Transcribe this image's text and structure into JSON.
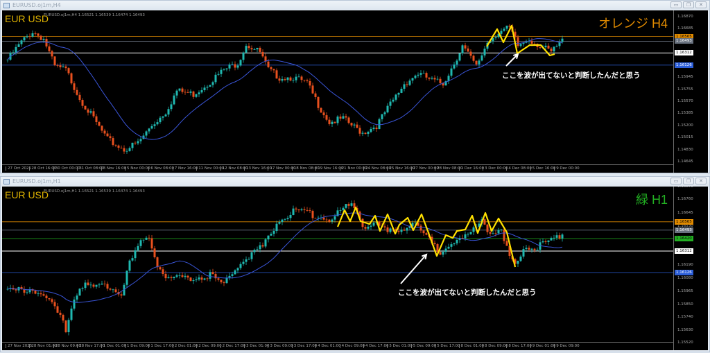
{
  "windows": [
    {
      "title": "EURUSD.oj1m,H4",
      "symbol": "EUR USD",
      "ohlc": "EURUSD.oj1m,H4 1.16521 1.16539 1.16474 1.16493",
      "timeframe_label": "オレンジ H4",
      "timeframe_color": "#e08a00",
      "note": "ここを波が出てないと判断したんだと思う"
    },
    {
      "title": "EURUSD.oj1m,H1",
      "symbol": "EUR USD",
      "ohlc": "EURUSD.oj1m,H1 1.16521 1.16539 1.16474 1.16493",
      "timeframe_label": "緑 H1",
      "timeframe_color": "#22b022",
      "note": "ここを波が出てないと判断したんだと思う"
    }
  ],
  "window_buttons": [
    "minimize",
    "restore",
    "close"
  ],
  "colors": {
    "up": "#1fb8b0",
    "down": "#e8501e",
    "ma": "#3a55d8",
    "zigzag": "#ffe000"
  },
  "chart_data": [
    {
      "type": "candlestick",
      "title": "EURUSD H4",
      "price_ticks": [
        "1.16870",
        "1.16685",
        "1.15945",
        "1.15755",
        "1.15570",
        "1.15385",
        "1.15200",
        "1.15015",
        "1.14830",
        "1.14645"
      ],
      "price_range": [
        1.14645,
        1.1687
      ],
      "date_ticks": [
        "27 Oct 2025",
        "28 Oct 16:00",
        "30 Oct 00:00",
        "31 Oct 08:00",
        "3 Nov 16:00",
        "5 Nov 00:00",
        "6 Nov 08:00",
        "7 Nov 16:00",
        "11 Nov 00:00",
        "12 Nov 08:00",
        "13 Nov 16:00",
        "17 Nov 00:00",
        "18 Nov 08:00",
        "19 Nov 16:00",
        "21 Nov 00:00",
        "24 Nov 08:00",
        "25 Nov 16:00",
        "27 Nov 00:00",
        "28 Nov 08:00",
        "1 Dec 16:00",
        "3 Dec 00:00",
        "4 Dec 08:00",
        "5 Dec 16:00",
        "9 Dec 00:00"
      ],
      "levels": [
        {
          "price": "1.16565",
          "color": "#e08a00",
          "text": "#000"
        },
        {
          "price": "1.16493",
          "color": "#6a7380",
          "text": "#fff"
        },
        {
          "price": "1.16312",
          "color": "#ffffff",
          "text": "#000"
        },
        {
          "price": "1.16126",
          "color": "#2c5ed8",
          "text": "#fff"
        }
      ],
      "close_path": [
        [
          0,
          1.1621
        ],
        [
          5,
          1.1648
        ],
        [
          9,
          1.1664
        ],
        [
          13,
          1.1653
        ],
        [
          17,
          1.161
        ],
        [
          21,
          1.1605
        ],
        [
          26,
          1.1562
        ],
        [
          31,
          1.153
        ],
        [
          36,
          1.1498
        ],
        [
          42,
          1.1483
        ],
        [
          47,
          1.1493
        ],
        [
          52,
          1.152
        ],
        [
          57,
          1.1541
        ],
        [
          61,
          1.1573
        ],
        [
          67,
          1.1568
        ],
        [
          72,
          1.1584
        ],
        [
          78,
          1.1605
        ],
        [
          83,
          1.1616
        ],
        [
          86,
          1.1645
        ],
        [
          91,
          1.1632
        ],
        [
          94,
          1.1605
        ],
        [
          98,
          1.1594
        ],
        [
          103,
          1.1594
        ],
        [
          108,
          1.1584
        ],
        [
          112,
          1.1552
        ],
        [
          116,
          1.1525
        ],
        [
          121,
          1.153
        ],
        [
          124,
          1.152
        ],
        [
          128,
          1.1509
        ],
        [
          133,
          1.152
        ],
        [
          138,
          1.1552
        ],
        [
          143,
          1.1584
        ],
        [
          148,
          1.16
        ],
        [
          153,
          1.1589
        ],
        [
          157,
          1.1584
        ],
        [
          161,
          1.1616
        ],
        [
          164,
          1.1642
        ],
        [
          169,
          1.161
        ],
        [
          173,
          1.1648
        ],
        [
          177,
          1.1664
        ],
        [
          181,
          1.1669
        ],
        [
          184,
          1.1642
        ],
        [
          188,
          1.1653
        ],
        [
          192,
          1.1642
        ],
        [
          196,
          1.1632
        ],
        [
          200,
          1.165
        ]
      ]
    },
    {
      "type": "candlestick",
      "title": "EURUSD H1",
      "price_ticks": [
        "1.16870",
        "1.16760",
        "1.16645",
        "1.16530",
        "1.16190",
        "1.16080",
        "1.15965",
        "1.15850",
        "1.15740",
        "1.15630",
        "1.15520"
      ],
      "price_range": [
        1.1552,
        1.1687
      ],
      "date_ticks": [
        "27 Nov 2025",
        "28 Nov 01:00",
        "28 Nov 09:00",
        "28 Nov 17:00",
        "1 Dec 01:00",
        "1 Dec 09:00",
        "1 Dec 17:00",
        "2 Dec 01:00",
        "2 Dec 09:00",
        "2 Dec 17:00",
        "3 Dec 01:00",
        "3 Dec 09:00",
        "3 Dec 17:00",
        "4 Dec 01:00",
        "4 Dec 09:00",
        "4 Dec 17:00",
        "5 Dec 01:00",
        "5 Dec 09:00",
        "5 Dec 17:00",
        "8 Dec 01:00",
        "8 Dec 09:00",
        "8 Dec 17:00",
        "9 Dec 01:00",
        "9 Dec 09:00"
      ],
      "levels": [
        {
          "price": "1.16565",
          "color": "#e08a00",
          "text": "#000"
        },
        {
          "price": "1.16493",
          "color": "#6a7380",
          "text": "#fff"
        },
        {
          "price": "1.16420",
          "color": "#22b022",
          "text": "#000"
        },
        {
          "price": "1.16312",
          "color": "#ffffff",
          "text": "#000"
        },
        {
          "price": "1.16126",
          "color": "#2c5ed8",
          "text": "#fff"
        }
      ],
      "close_path": [
        [
          0,
          1.15958
        ],
        [
          8,
          1.15988
        ],
        [
          13,
          1.15928
        ],
        [
          18,
          1.15778
        ],
        [
          21,
          1.15628
        ],
        [
          23,
          1.15838
        ],
        [
          26,
          1.16018
        ],
        [
          31,
          1.15988
        ],
        [
          36,
          1.16018
        ],
        [
          41,
          1.15958
        ],
        [
          44,
          1.16198
        ],
        [
          48,
          1.16378
        ],
        [
          51,
          1.16438
        ],
        [
          54,
          1.16198
        ],
        [
          58,
          1.16078
        ],
        [
          63,
          1.16078
        ],
        [
          68,
          1.16078
        ],
        [
          73,
          1.16108
        ],
        [
          78,
          1.16018
        ],
        [
          81,
          1.16138
        ],
        [
          86,
          1.16258
        ],
        [
          92,
          1.16348
        ],
        [
          97,
          1.16558
        ],
        [
          102,
          1.16648
        ],
        [
          107,
          1.16648
        ],
        [
          112,
          1.16618
        ],
        [
          117,
          1.16588
        ],
        [
          122,
          1.16708
        ],
        [
          126,
          1.16678
        ],
        [
          128,
          1.16528
        ],
        [
          132,
          1.16558
        ],
        [
          137,
          1.16468
        ],
        [
          142,
          1.16498
        ],
        [
          146,
          1.16558
        ],
        [
          151,
          1.16438
        ],
        [
          156,
          1.16288
        ],
        [
          159,
          1.16378
        ],
        [
          163,
          1.16408
        ],
        [
          166,
          1.16438
        ],
        [
          171,
          1.16588
        ],
        [
          174,
          1.16468
        ],
        [
          178,
          1.16468
        ],
        [
          181,
          1.16258
        ],
        [
          183,
          1.16168
        ],
        [
          186,
          1.16348
        ],
        [
          191,
          1.16348
        ],
        [
          196,
          1.16408
        ],
        [
          200,
          1.16468
        ]
      ]
    }
  ]
}
